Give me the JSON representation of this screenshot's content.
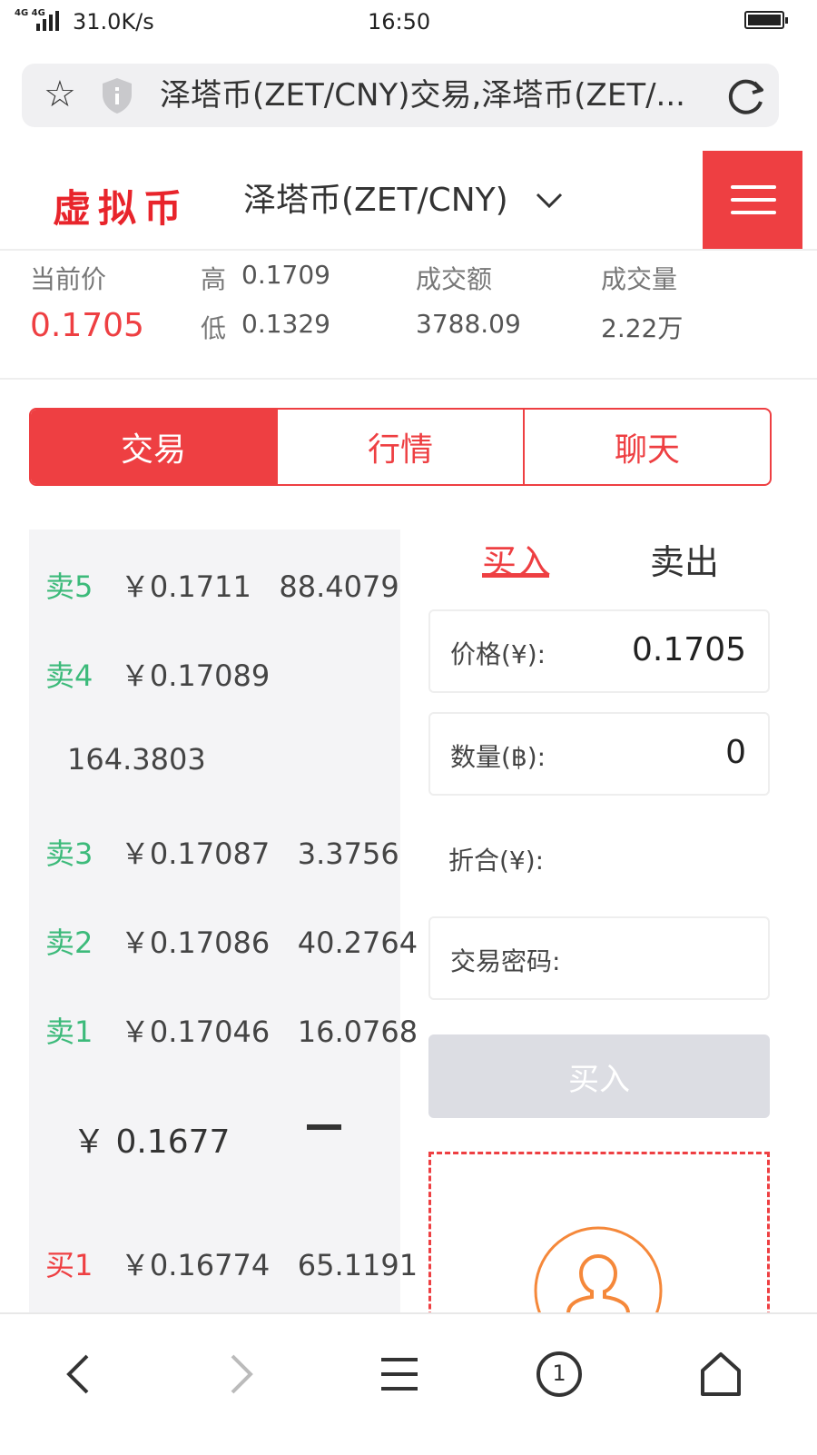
{
  "status_bar": {
    "network": "4G 4G",
    "speed": "31.0K/s",
    "time": "16:50"
  },
  "browser": {
    "url_title": "泽塔币(ZET/CNY)交易,泽塔币(ZET/...",
    "icons": [
      "star-icon",
      "shield-icon",
      "reload-icon"
    ]
  },
  "header": {
    "logo": "虚拟币",
    "pair": "泽塔币(ZET/CNY)",
    "menu_icon": "hamburger-icon",
    "accent_color": "#ee3f42"
  },
  "stats": {
    "current_label": "当前价",
    "current_value": "0.1705",
    "high_label": "高",
    "high_value": "0.1709",
    "low_label": "低",
    "low_value": "0.1329",
    "turnover_label": "成交额",
    "turnover_value": "3788.09",
    "volume_label": "成交量",
    "volume_value": "2.22万"
  },
  "tabs": [
    {
      "label": "交易",
      "active": true
    },
    {
      "label": "行情",
      "active": false
    },
    {
      "label": "聊天",
      "active": false
    }
  ],
  "order_book": {
    "asks": [
      {
        "label": "卖5",
        "price": "￥0.1711",
        "amount": "88.4079"
      },
      {
        "label": "卖4",
        "price": "￥0.17089",
        "amount": "164.3803"
      },
      {
        "label": "卖3",
        "price": "￥0.17087",
        "amount": "3.3756"
      },
      {
        "label": "卖2",
        "price": "￥0.17086",
        "amount": "40.2764"
      },
      {
        "label": "卖1",
        "price": "￥0.17046",
        "amount": "16.0768"
      }
    ],
    "mid_price": "￥ 0.1677",
    "bids": [
      {
        "label": "买1",
        "price": "￥0.16774",
        "amount": "65.1191"
      }
    ],
    "sell_color": "#3cba7a",
    "buy_color": "#ee3f42"
  },
  "trade": {
    "buy_tab": "买入",
    "sell_tab": "卖出",
    "price_label": "价格(¥):",
    "price_value": "0.1705",
    "qty_label": "数量(฿):",
    "qty_value": "0",
    "total_label": "折合(¥):",
    "password_label": "交易密码:",
    "submit_label": "买入"
  },
  "bottom_nav": [
    "back-icon",
    "forward-icon",
    "menu-icon",
    "tabs-icon",
    "home-icon"
  ],
  "bottom_nav_tab_count": "1"
}
